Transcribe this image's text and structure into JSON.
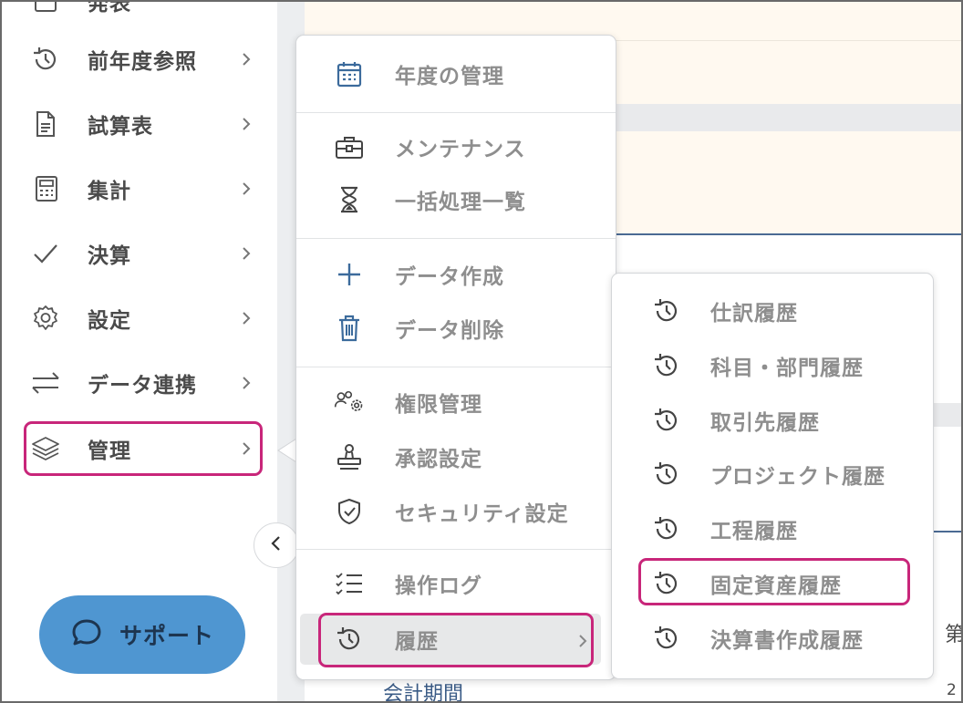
{
  "sidebar": {
    "items": [
      {
        "label": "発表",
        "icon": "partial-icon"
      },
      {
        "label": "前年度参照",
        "icon": "history-icon"
      },
      {
        "label": "試算表",
        "icon": "document-icon"
      },
      {
        "label": "集計",
        "icon": "calculator-icon"
      },
      {
        "label": "決算",
        "icon": "check-icon"
      },
      {
        "label": "設定",
        "icon": "gear-icon"
      },
      {
        "label": "データ連携",
        "icon": "exchange-icon"
      },
      {
        "label": "管理",
        "icon": "layers-icon"
      }
    ],
    "support_label": "サポート"
  },
  "menu": {
    "items": [
      {
        "label": "年度の管理",
        "icon": "calendar-icon"
      },
      {
        "label": "メンテナンス",
        "icon": "toolbox-icon"
      },
      {
        "label": "一括処理一覧",
        "icon": "hourglass-icon"
      },
      {
        "label": "データ作成",
        "icon": "plus-icon"
      },
      {
        "label": "データ削除",
        "icon": "trash-icon"
      },
      {
        "label": "権限管理",
        "icon": "users-gear-icon"
      },
      {
        "label": "承認設定",
        "icon": "stamp-icon"
      },
      {
        "label": "セキュリティ設定",
        "icon": "shield-check-icon"
      },
      {
        "label": "操作ログ",
        "icon": "checklist-icon"
      },
      {
        "label": "履歴",
        "icon": "history-icon"
      }
    ]
  },
  "submenu": {
    "items": [
      {
        "label": "仕訳履歴",
        "icon": "history-icon"
      },
      {
        "label": "科目・部門履歴",
        "icon": "history-icon"
      },
      {
        "label": "取引先履歴",
        "icon": "history-icon"
      },
      {
        "label": "プロジェクト履歴",
        "icon": "history-icon"
      },
      {
        "label": "工程履歴",
        "icon": "history-icon"
      },
      {
        "label": "固定資産履歴",
        "icon": "history-icon"
      },
      {
        "label": "決算書作成履歴",
        "icon": "history-icon"
      }
    ]
  },
  "background": {
    "period_label": "会計期間",
    "side_text_1": "第",
    "side_text_2": "2"
  },
  "colors": {
    "highlight": "#c8267a",
    "support_button": "#4f96d1",
    "icon_blue": "#3c6b9c",
    "active_row": "#e7e8e9"
  }
}
